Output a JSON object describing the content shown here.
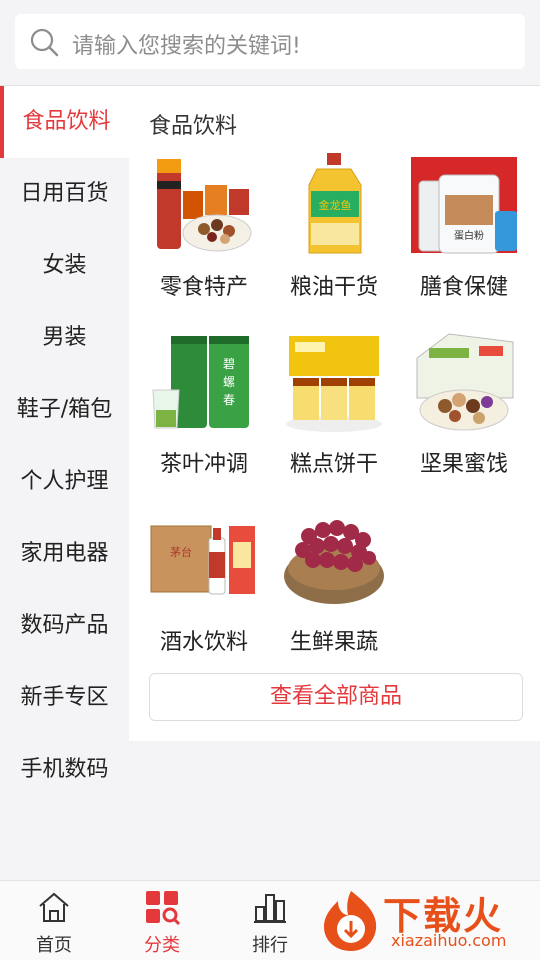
{
  "search": {
    "placeholder": "请输入您搜索的关键词!"
  },
  "sidebar": {
    "items": [
      {
        "label": "食品饮料",
        "active": true
      },
      {
        "label": "日用百货"
      },
      {
        "label": "女装"
      },
      {
        "label": "男装"
      },
      {
        "label": "鞋子/箱包"
      },
      {
        "label": "个人护理"
      },
      {
        "label": "家用电器"
      },
      {
        "label": "数码产品"
      },
      {
        "label": "新手专区"
      },
      {
        "label": "手机数码"
      }
    ]
  },
  "content": {
    "title": "食品饮料",
    "products": [
      {
        "label": "零食特产",
        "icon": "snacks-image"
      },
      {
        "label": "粮油干货",
        "icon": "cooking-oil-image"
      },
      {
        "label": "膳食保健",
        "icon": "protein-powder-image"
      },
      {
        "label": "茶叶冲调",
        "icon": "tea-cans-image"
      },
      {
        "label": "糕点饼干",
        "icon": "cake-image"
      },
      {
        "label": "坚果蜜饯",
        "icon": "nuts-image"
      },
      {
        "label": "酒水饮料",
        "icon": "liquor-image"
      },
      {
        "label": "生鲜果蔬",
        "icon": "grapes-image"
      }
    ],
    "view_all": "查看全部商品"
  },
  "tabbar": {
    "tabs": [
      {
        "label": "首页",
        "icon": "home-icon"
      },
      {
        "label": "分类",
        "icon": "category-icon",
        "active": true
      },
      {
        "label": "排行",
        "icon": "ranking-icon"
      }
    ]
  },
  "watermark": {
    "text": "下载火",
    "sub": "xiazaihuo.com"
  },
  "colors": {
    "accent": "#e4393c",
    "watermark": "#e8501a",
    "background": "#f4f4f6"
  }
}
